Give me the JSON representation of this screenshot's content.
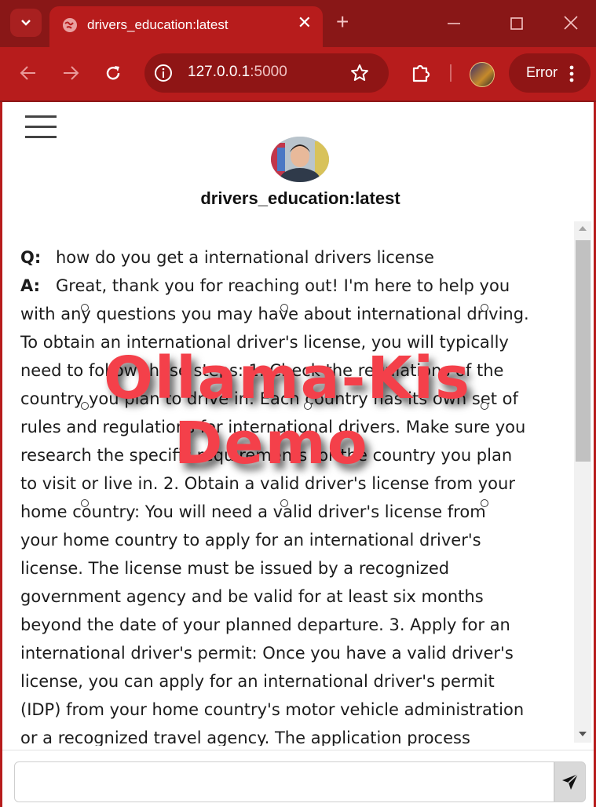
{
  "browser": {
    "tab_title": "drivers_education:latest",
    "new_tab_symbol": "+",
    "url_host": "127.0.0.1",
    "url_port": ":5000",
    "status_label": "Error"
  },
  "page": {
    "model_title": "drivers_education:latest",
    "question_label": "Q:",
    "answer_label": "A:",
    "question_text": "how do you get a international drivers license",
    "answer_lines": [
      "Great, thank you for reaching out! I'm here to help you",
      "with any questions you may have about international driving.",
      "To obtain an international driver's license, you will typically",
      "need to follow these steps: 1. Check the regulations of the",
      "country you plan to drive in: Each country has its own set of",
      "rules and regulations for international drivers. Make sure you",
      "research the specific requirements for the country you plan",
      "to visit or live in. 2. Obtain a valid driver's license from your",
      "home country: You will need a valid driver's license from",
      "your home country to apply for an international driver's",
      "license. The license must be issued by a recognized",
      "government agency and be valid for at least six months",
      "beyond the date of your planned departure. 3. Apply for an",
      "international driver's permit: Once you have a valid driver's",
      "license, you can apply for an international driver's permit",
      "(IDP) from your home country's motor vehicle administration",
      "or a recognized travel agency. The application process"
    ],
    "input_value": "",
    "input_placeholder": ""
  },
  "watermark": {
    "line1": "Ollama-Kis",
    "line2": "Demo"
  },
  "colors": {
    "chrome": "#b71c1c",
    "tabstrip": "#891717",
    "watermark": "#f4404a"
  }
}
